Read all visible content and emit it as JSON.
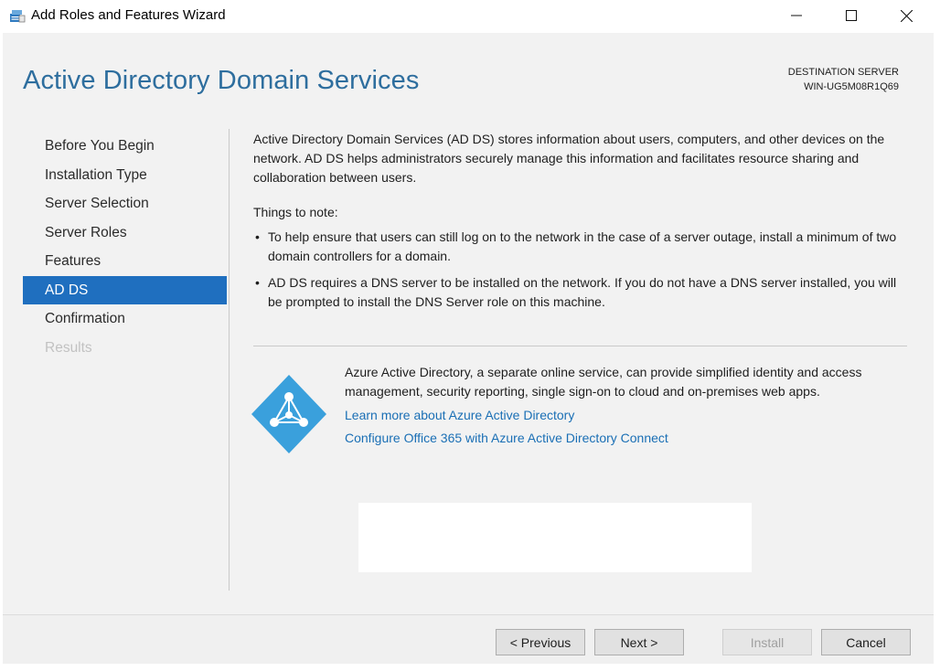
{
  "window": {
    "title": "Add Roles and Features Wizard",
    "icons": {
      "app": "server-manager-icon",
      "minimize": "minimize-icon",
      "maximize": "maximize-icon",
      "close": "close-icon"
    }
  },
  "page": {
    "title": "Active Directory Domain Services",
    "destination_label": "DESTINATION SERVER",
    "destination_server": "WIN-UG5M08R1Q69"
  },
  "nav": {
    "items": [
      {
        "label": "Before You Begin",
        "state": "normal"
      },
      {
        "label": "Installation Type",
        "state": "normal"
      },
      {
        "label": "Server Selection",
        "state": "normal"
      },
      {
        "label": "Server Roles",
        "state": "normal"
      },
      {
        "label": "Features",
        "state": "normal"
      },
      {
        "label": "AD DS",
        "state": "active"
      },
      {
        "label": "Confirmation",
        "state": "normal"
      },
      {
        "label": "Results",
        "state": "disabled"
      }
    ]
  },
  "content": {
    "intro": "Active Directory Domain Services (AD DS) stores information about users, computers, and other devices on the network.  AD DS helps administrators securely manage this information and facilitates resource sharing and collaboration between users.",
    "notes_heading": "Things to note:",
    "notes": [
      "To help ensure that users can still log on to the network in the case of a server outage, install a minimum of two domain controllers for a domain.",
      "AD DS requires a DNS server to be installed on the network.  If you do not have a DNS server installed, you will be prompted to install the DNS Server role on this machine."
    ]
  },
  "azure": {
    "icon": "azure-active-directory-icon",
    "description": "Azure Active Directory, a separate online service, can provide simplified identity and access management, security reporting, single sign-on to cloud and on-premises web apps.",
    "link_learn_more": "Learn more about Azure Active Directory",
    "link_configure": "Configure Office 365 with Azure Active Directory Connect"
  },
  "footer": {
    "previous": "< Previous",
    "next": "Next >",
    "install": "Install",
    "cancel": "Cancel"
  },
  "colors": {
    "accent": "#1f6fbf",
    "title": "#2e6e9e",
    "link": "#1a6fb5",
    "azure_icon": "#3aa0dc"
  }
}
